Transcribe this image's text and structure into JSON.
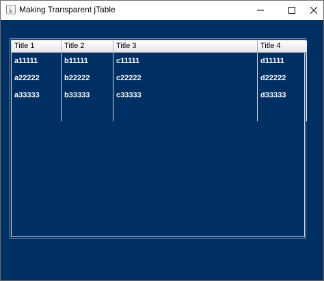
{
  "window": {
    "title": "Making Transparent jTable"
  },
  "table": {
    "headers": [
      "Title 1",
      "Title 2",
      "Title 3",
      "Title 4"
    ],
    "rows": [
      [
        "a11111",
        "b11111",
        "c11111",
        "d11111"
      ],
      [
        "a22222",
        "b22222",
        "c22222",
        "d22222"
      ],
      [
        "a33333",
        "b33333",
        "c33333",
        "d33333"
      ]
    ]
  },
  "colors": {
    "content_background": "#002f64",
    "cell_text": "#ffffff"
  },
  "icons": {
    "app": "java-icon",
    "minimize": "minimize-icon",
    "maximize": "maximize-icon",
    "close": "close-icon"
  }
}
